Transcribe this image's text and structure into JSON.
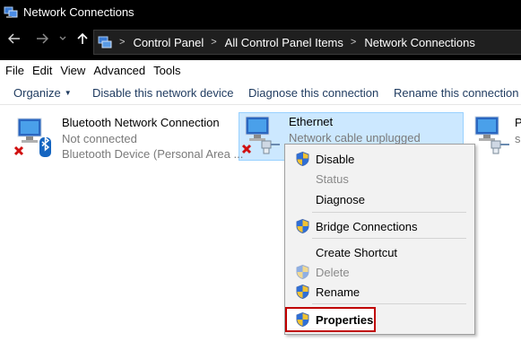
{
  "window": {
    "title": "Network Connections"
  },
  "navigation": {
    "back_icon": "arrow-left-icon",
    "forward_icon": "arrow-right-icon",
    "recent_icon": "chevron-down-icon",
    "up_icon": "arrow-up-icon",
    "breadcrumbs": [
      "Control Panel",
      "All Control Panel Items",
      "Network Connections"
    ]
  },
  "menu": [
    "File",
    "Edit",
    "View",
    "Advanced",
    "Tools"
  ],
  "toolbar": {
    "organize": "Organize",
    "disable": "Disable this network device",
    "diagnose": "Diagnose this connection",
    "rename": "Rename this connection"
  },
  "connections": [
    {
      "name": "Bluetooth Network Connection",
      "status": "Not connected",
      "device": "Bluetooth Device (Personal Area ..."
    },
    {
      "name": "Ethernet",
      "status": "Network cable unplugged",
      "device": ""
    },
    {
      "name": "P",
      "status": "s",
      "device": ""
    }
  ],
  "context_menu": {
    "items": [
      {
        "label": "Disable",
        "shield": true,
        "disabled": false,
        "bold": false
      },
      {
        "label": "Status",
        "shield": false,
        "disabled": true,
        "bold": false
      },
      {
        "label": "Diagnose",
        "shield": false,
        "disabled": false,
        "bold": false
      },
      {
        "label": "Bridge Connections",
        "shield": true,
        "disabled": false,
        "bold": false
      },
      {
        "label": "Create Shortcut",
        "shield": false,
        "disabled": false,
        "bold": false
      },
      {
        "label": "Delete",
        "shield": true,
        "disabled": true,
        "bold": false
      },
      {
        "label": "Rename",
        "shield": true,
        "disabled": false,
        "bold": false
      },
      {
        "label": "Properties",
        "shield": true,
        "disabled": false,
        "bold": true
      }
    ]
  },
  "colors": {
    "selection": "#cce8ff",
    "highlight_box": "#c00000",
    "titlebar": "#000000"
  }
}
